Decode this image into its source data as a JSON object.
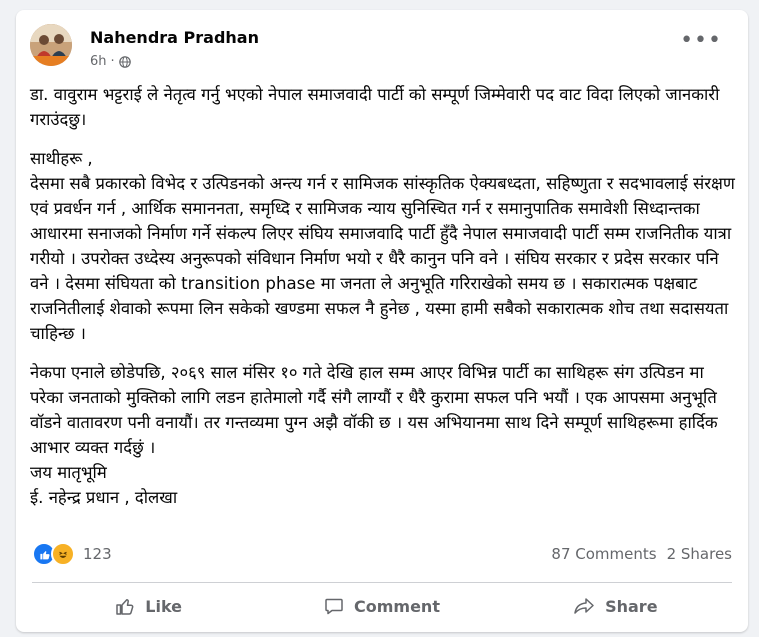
{
  "post": {
    "author": "Nahendra Pradhan",
    "time": "6h",
    "privacy_icon": "globe-icon",
    "paragraphs": [
      "डा. वावुराम भट्टराई ले नेतृत्व गर्नु भएको नेपाल समाजवादी पार्टी को सम्पूर्ण जिम्मेवारी पद वाट विदा लिएको जानकारी गराउंदछु।",
      "साथीहरू ,\nदेसमा सबै प्रकारको विभेद र उत्पिडनको अन्त्य गर्न र सामिजक सांस्कृतिक ऐक्यबध्दता, सहिष्णुता र सदभावलाई संरक्षण एवं प्रवर्धन गर्न , आर्थिक समाननता, समृध्दि र सामिजक न्याय सुनिस्चित गर्न र समानुपातिक समावेशी सिध्दान्तका आधारमा सनाजको निर्माण गर्ने संकल्प लिएर संघिय समाजवादि पार्टी हुँदै नेपाल समाजवादी पार्टी सम्म राजनितीक यात्रा गरीयो । उपरोक्त उध्देस्य अनुरूपको संविधान निर्माण भयो र धैरै कानुन पनि वने । संघिय सरकार र प्रदेस सरकार पनि वने । देसमा संघियता को transition phase मा जनता ले अनुभूति गरिराखेको समय छ । सकारात्मक पक्षबाट राजनितीलाई शेवाको रूपमा लिन सकेको खण्डमा सफल नै हुनेछ , यस्मा हामी सबैको सकारात्मक शोच तथा सदासयता चाहिन्छ ।",
      "नेकपा एनाले छोडेपछि, २०६९ साल मंसिर १० गते देखि हाल सम्म आएर विभिन्न पार्टी का साथिहरू संग उत्पिडन मा परेका जनताको मुक्तिको लागि लडन हातेमालो गर्दै संगै लाग्यौं र धैरै कुरामा सफल पनि भयौं । एक आपसमा अनुभूति वॉडने वातावरण पनी वनायौं। तर गन्तव्यमा पुग्न अझै वॉकी छ । यस अभियानमा साथ दिने सम्पूर्ण साथिहरूमा हार्दिक आभार व्यक्त गर्दछुं ।\nजय मातृभूमि\nई. नहेन्द्र प्रधान , दोलखा"
    ]
  },
  "stats": {
    "reaction_count": "123",
    "comments": "87 Comments",
    "shares": "2 Shares"
  },
  "actions": {
    "like": "Like",
    "comment": "Comment",
    "share": "Share"
  },
  "colors": {
    "accent": "#1877f2",
    "haha": "#f7b125",
    "muted": "#65676b"
  }
}
